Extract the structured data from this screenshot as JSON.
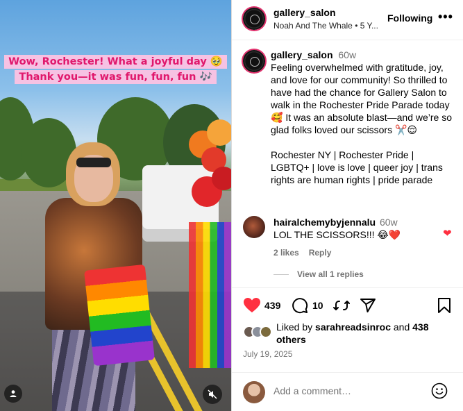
{
  "media": {
    "caption_line1": "Wow, Rochester! What a joyful day 🥹",
    "caption_line2": "Thank you—it was fun, fun, fun 🎶"
  },
  "header": {
    "username": "gallery_salon",
    "audio": "Noah And The Whale • 5 Y...",
    "follow_label": "Following",
    "more_label": "•••"
  },
  "post": {
    "username": "gallery_salon",
    "age": "60w",
    "caption": "Feeling overwhelmed with gratitude, joy, and love for our community! So thrilled to have had the chance for Gallery Salon to walk in the Rochester Pride Parade today 🥰 It was an absolute blast—and we’re so glad folks loved our scissors ✂️😌",
    "hashtags": "Rochester NY | Rochester Pride | LGBTQ+ | love is love | queer joy | trans rights are human rights | pride parade"
  },
  "comment": {
    "username": "hairalchemybyjennalu",
    "age": "60w",
    "text": "LOL THE SCISSORS!!! 😂❤️",
    "likes": "2 likes",
    "reply_label": "Reply",
    "view_replies": "View all 1 replies"
  },
  "actions": {
    "like_count": "439",
    "comment_count": "10"
  },
  "likes": {
    "prefix": "Liked by",
    "user": "sarahreadsinroc",
    "joiner": "and",
    "others": "438 others"
  },
  "date": "July 19, 2025",
  "add_comment": {
    "placeholder": "Add a comment…"
  },
  "colors": {
    "like_red": "#ff3040",
    "caption_pink": "#e0186c",
    "caption_bg": "#f6c2e3"
  }
}
